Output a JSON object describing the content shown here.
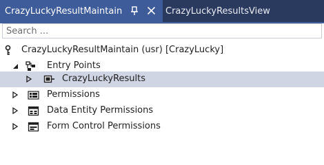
{
  "tabs": [
    {
      "label": "CrazyLuckyResultMaintain",
      "active": true
    },
    {
      "label": "CrazyLuckyResultsView",
      "active": false
    }
  ],
  "search": {
    "placeholder": "Search ..."
  },
  "tree": {
    "root": {
      "label": "CrazyLuckyResultMaintain (usr) [CrazyLucky]",
      "icon": "key-icon"
    },
    "items": [
      {
        "label": "Entry Points",
        "icon": "entry-points-icon",
        "expanded": true
      },
      {
        "label": "CrazyLuckyResults",
        "icon": "menu-item-icon",
        "expanded": false,
        "selected": true
      },
      {
        "label": "Permissions",
        "icon": "permissions-icon",
        "expanded": false
      },
      {
        "label": "Data Entity Permissions",
        "icon": "data-entity-icon",
        "expanded": false
      },
      {
        "label": "Form Control Permissions",
        "icon": "form-control-icon",
        "expanded": false
      }
    ]
  },
  "colors": {
    "tab_strip": "#2a3a5e",
    "active_tab": "#3e5b9a",
    "selection": "#cfd5e3"
  }
}
